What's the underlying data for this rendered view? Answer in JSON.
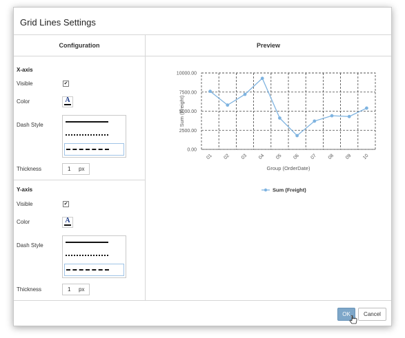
{
  "dialog": {
    "title": "Grid Lines Settings",
    "configuration_header": "Configuration",
    "preview_header": "Preview"
  },
  "x_axis": {
    "title": "X-axis",
    "visible_label": "Visible",
    "visible_checked": true,
    "color_label": "Color",
    "dash_label": "Dash Style",
    "dash_options": [
      "solid",
      "dotted",
      "dashed"
    ],
    "dash_selected": "dashed",
    "thickness_label": "Thickness",
    "thickness_value": "1",
    "thickness_unit": "px"
  },
  "y_axis": {
    "title": "Y-axis",
    "visible_label": "Visible",
    "visible_checked": true,
    "color_label": "Color",
    "dash_label": "Dash Style",
    "dash_options": [
      "solid",
      "dotted",
      "dashed"
    ],
    "dash_selected": "dashed",
    "thickness_label": "Thickness",
    "thickness_value": "1",
    "thickness_unit": "px"
  },
  "color_icon_letter": "A",
  "chart_data": {
    "type": "line",
    "x": [
      "01",
      "02",
      "03",
      "04",
      "05",
      "06",
      "07",
      "08",
      "09",
      "10"
    ],
    "series": [
      {
        "name": "Sum (Freight)",
        "values": [
          7600,
          5800,
          7200,
          9300,
          4100,
          1800,
          3700,
          4400,
          4300,
          5400
        ]
      }
    ],
    "xlabel": "Group (OrderDate)",
    "ylabel": "Sum (Freight)",
    "y_ticks": [
      "0.00",
      "2500.00",
      "5000.00",
      "7500.00",
      "10000.00"
    ],
    "ylim": [
      0,
      10000
    ],
    "grid": true,
    "grid_style": "dashed",
    "legend_position": "bottom",
    "series_color": "#7eb3e0"
  },
  "buttons": {
    "ok": "OK",
    "cancel": "Cancel"
  }
}
